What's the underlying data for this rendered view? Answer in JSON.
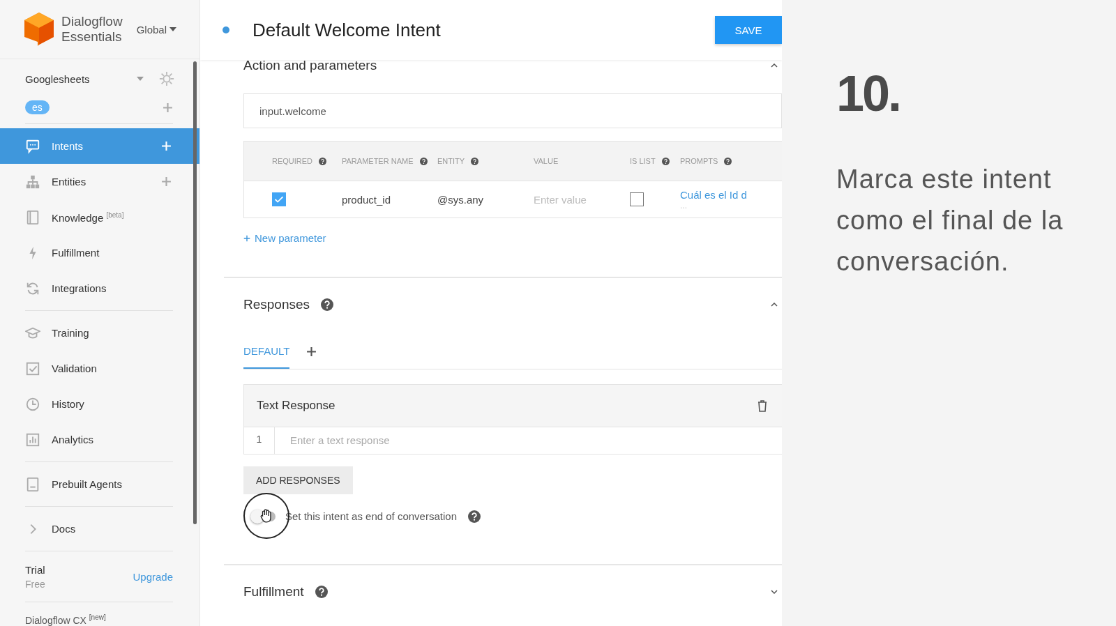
{
  "sidebar": {
    "brand_line1": "Dialogflow",
    "brand_line2": "Essentials",
    "region": "Global",
    "agent": "Googlesheets",
    "language": "es",
    "items": [
      {
        "label": "Intents",
        "selected": true,
        "has_add": true
      },
      {
        "label": "Entities",
        "selected": false,
        "has_add": true
      },
      {
        "label": "Knowledge $^{[beta]}$",
        "selected": false,
        "has_add": false
      },
      {
        "label": "Fulfillment",
        "selected": false,
        "has_add": false
      },
      {
        "label": "Integrations",
        "selected": false,
        "has_add": false
      },
      {
        "label": "Training",
        "selected": false,
        "has_add": false
      },
      {
        "label": "Validation",
        "selected": false,
        "has_add": false
      },
      {
        "label": "History",
        "selected": false,
        "has_add": false
      },
      {
        "label": "Analytics",
        "selected": false,
        "has_add": false
      },
      {
        "label": "Prebuilt Agents",
        "selected": false,
        "has_add": false
      },
      {
        "label": "Docs",
        "selected": false,
        "has_add": false
      }
    ],
    "plan": "Trial",
    "plan_tier": "Free",
    "upgrade": "Upgrade",
    "footer": "Dialogflow CX $^{[new]}$"
  },
  "header": {
    "title": "Default Welcome Intent",
    "save": "SAVE"
  },
  "action": {
    "title": "Action and parameters",
    "action_value": "input.welcome",
    "columns": [
      {
        "label": "REQUIRED",
        "help": true
      },
      {
        "label": "PARAMETER NAME",
        "help": true
      },
      {
        "label": "ENTITY",
        "help": true
      },
      {
        "label": "VALUE",
        "help": false
      },
      {
        "label": "IS LIST",
        "help": true
      },
      {
        "label": "PROMPTS",
        "help": true
      }
    ],
    "rows": [
      {
        "required": true,
        "name": "product_id",
        "entity": "@sys.any",
        "value_placeholder": "Enter value",
        "is_list": false,
        "prompt": "Cuál es el Id d",
        "prompt_more": "..."
      }
    ],
    "new_parameter": "New parameter"
  },
  "responses": {
    "title": "Responses",
    "tabs": [
      {
        "label": "DEFAULT",
        "selected": true
      }
    ],
    "card_title": "Text Response",
    "line_number": "1",
    "placeholder": "Enter a text response",
    "add": "ADD RESPONSES",
    "end_toggle": {
      "label": "Set this intent as end of conversation",
      "on": false
    }
  },
  "fulfillment": {
    "title": "Fulfillment"
  },
  "overlay": {
    "step": "10.",
    "text": "Marca este intent como el final de la conversación."
  }
}
